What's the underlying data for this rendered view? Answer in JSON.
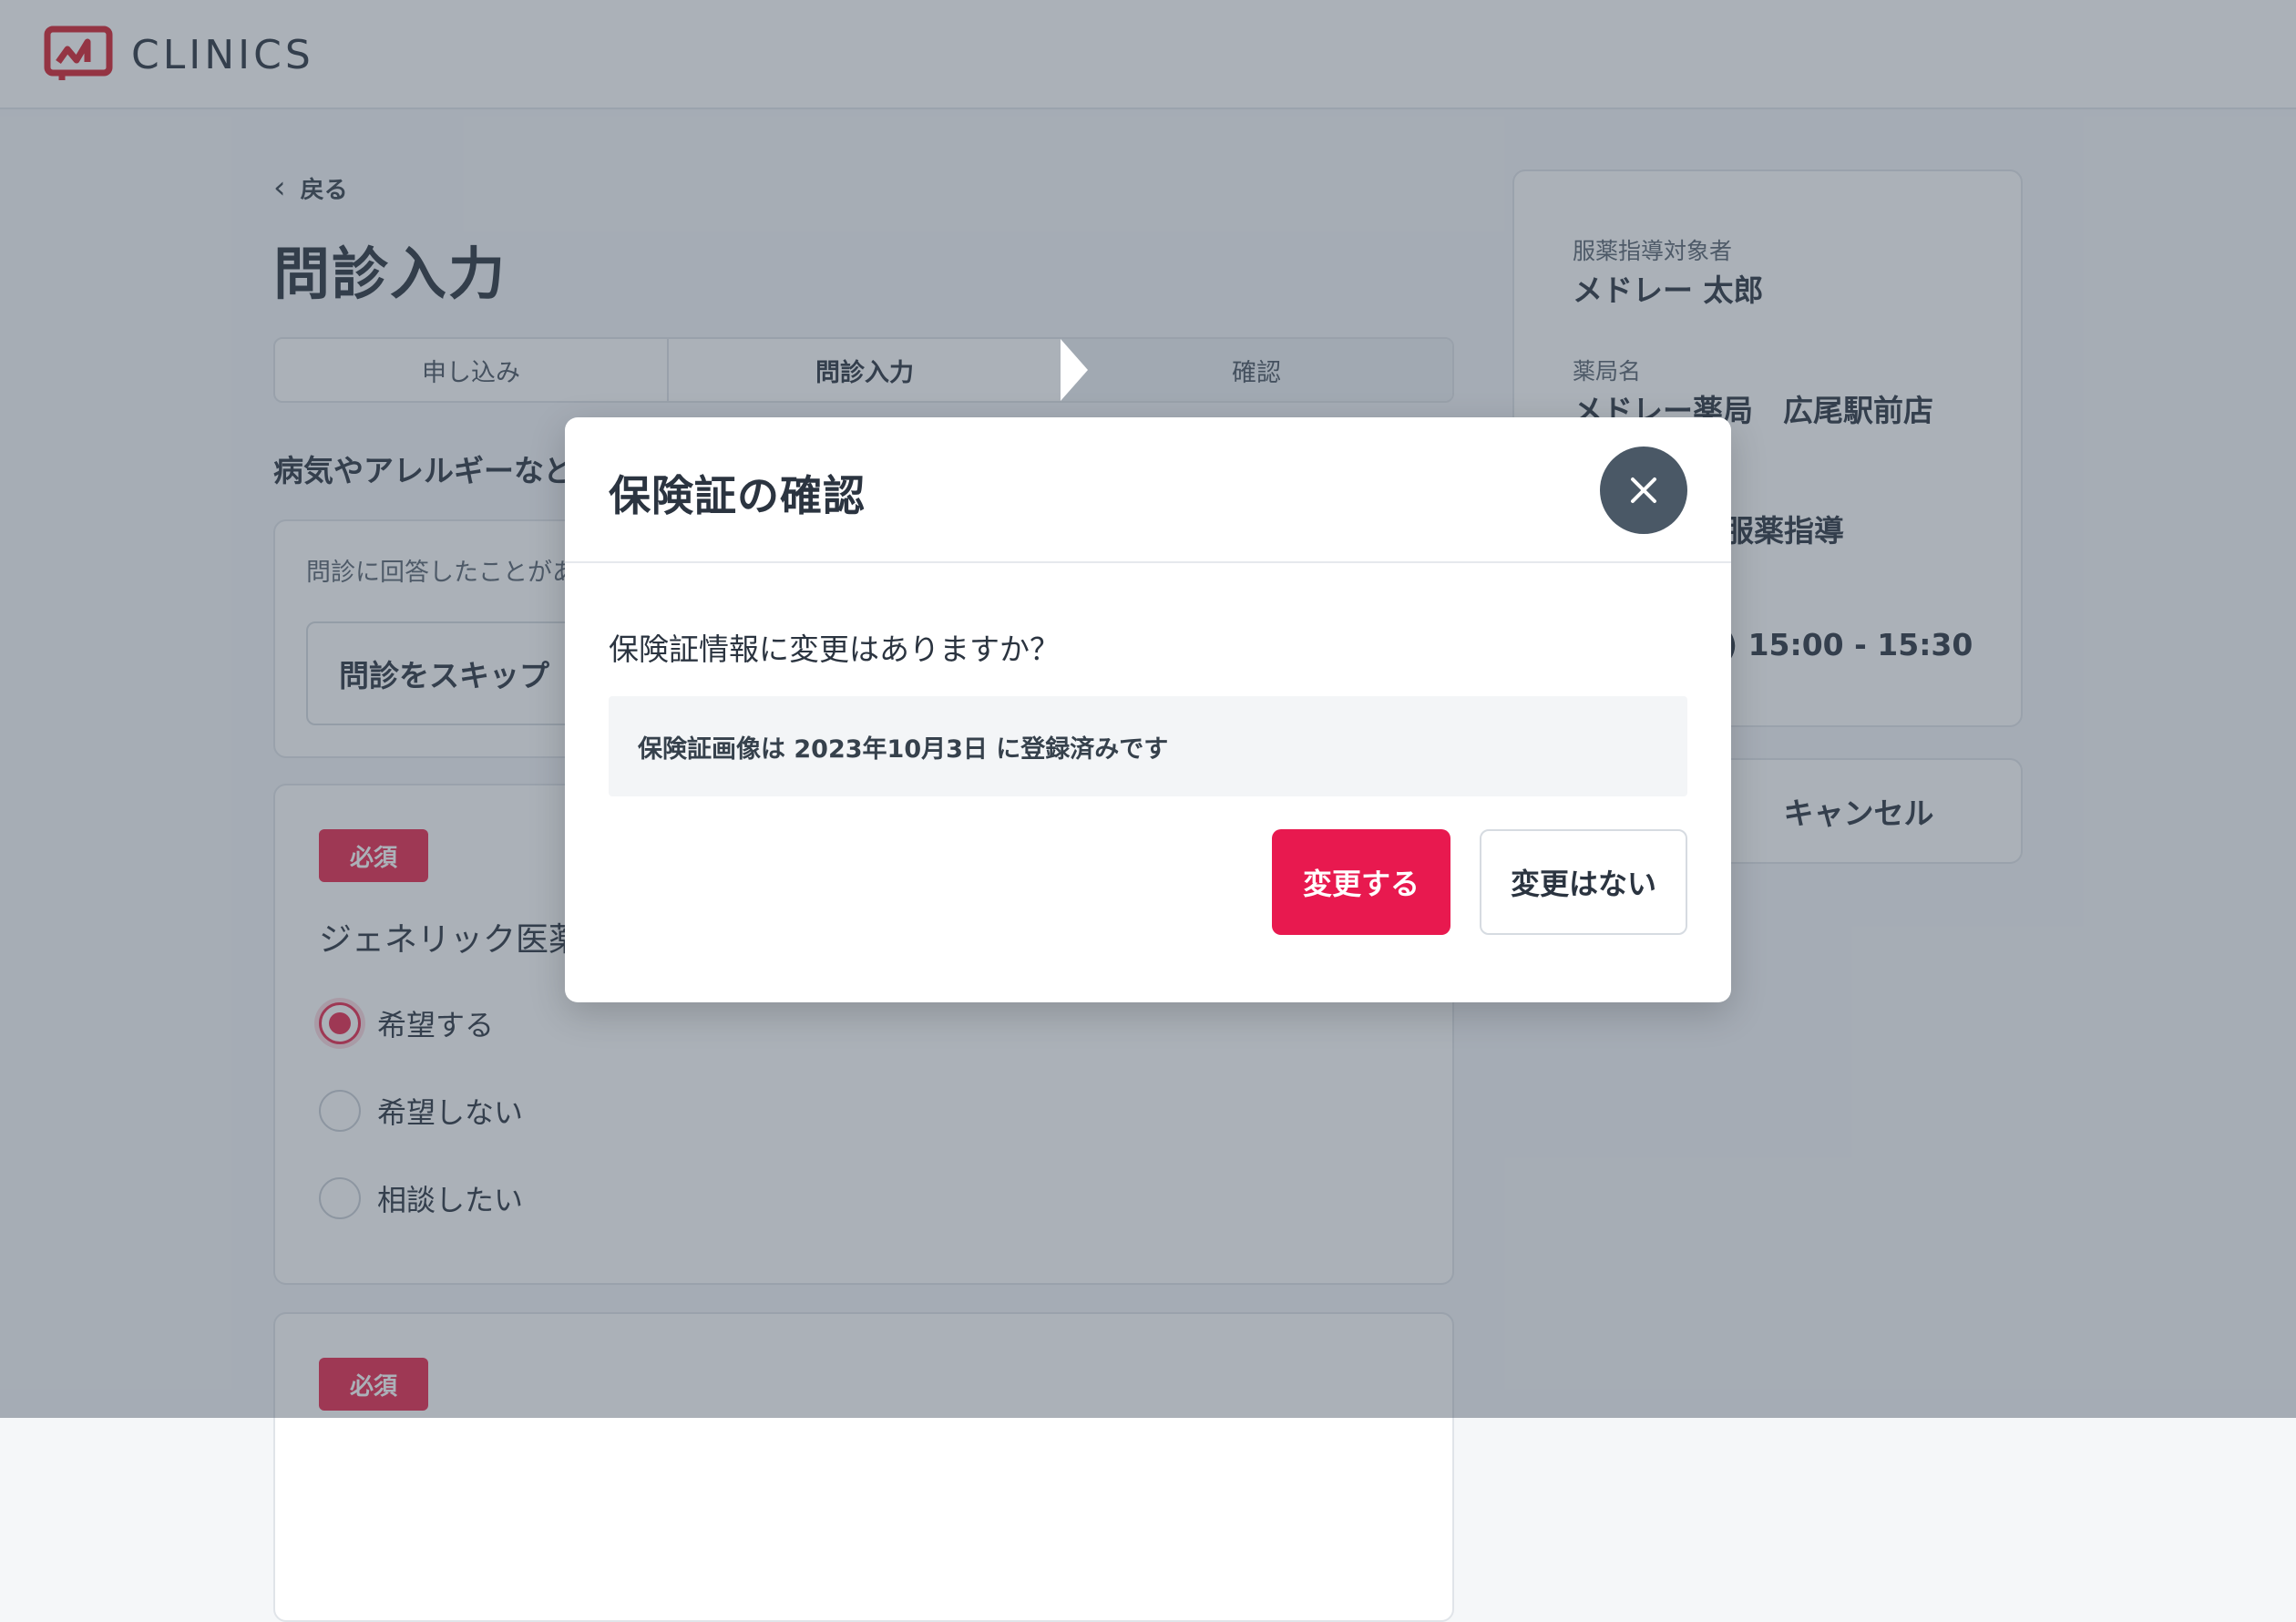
{
  "app": {
    "logo_text": "CLINICS",
    "brand_color": "#e8194f"
  },
  "nav": {
    "back_label": "戻る"
  },
  "page": {
    "title": "問診入力"
  },
  "stepper": {
    "steps": [
      "申し込み",
      "問診入力",
      "確認"
    ],
    "active_index": 1
  },
  "section": {
    "heading": "病気やアレルギーなど"
  },
  "skip_card": {
    "note": "問診に回答したことがあ",
    "skip_label": "問診をスキップ"
  },
  "question_card": {
    "required_label": "必須",
    "question": "ジェネリック医薬",
    "options": [
      "希望する",
      "希望しない",
      "相談したい"
    ],
    "selected_index": 0
  },
  "question_card_2": {
    "required_label": "必須"
  },
  "side": {
    "patient_label": "服薬指導対象者",
    "patient_value": "メドレー 太郎",
    "pharmacy_label": "薬局名",
    "pharmacy_value": "メドレー薬局　広尾駅前店",
    "service_value": "服薬指導",
    "time_value": ") 15:00 - 15:30",
    "cancel_label": "キャンセル"
  },
  "modal": {
    "title": "保険証の確認",
    "question": "保険証情報に変更はありますか？",
    "note": "保険証画像は 2023年10月3日 に登録済みです",
    "change_label": "変更する",
    "no_change_label": "変更はない",
    "close_icon": "close-icon"
  }
}
